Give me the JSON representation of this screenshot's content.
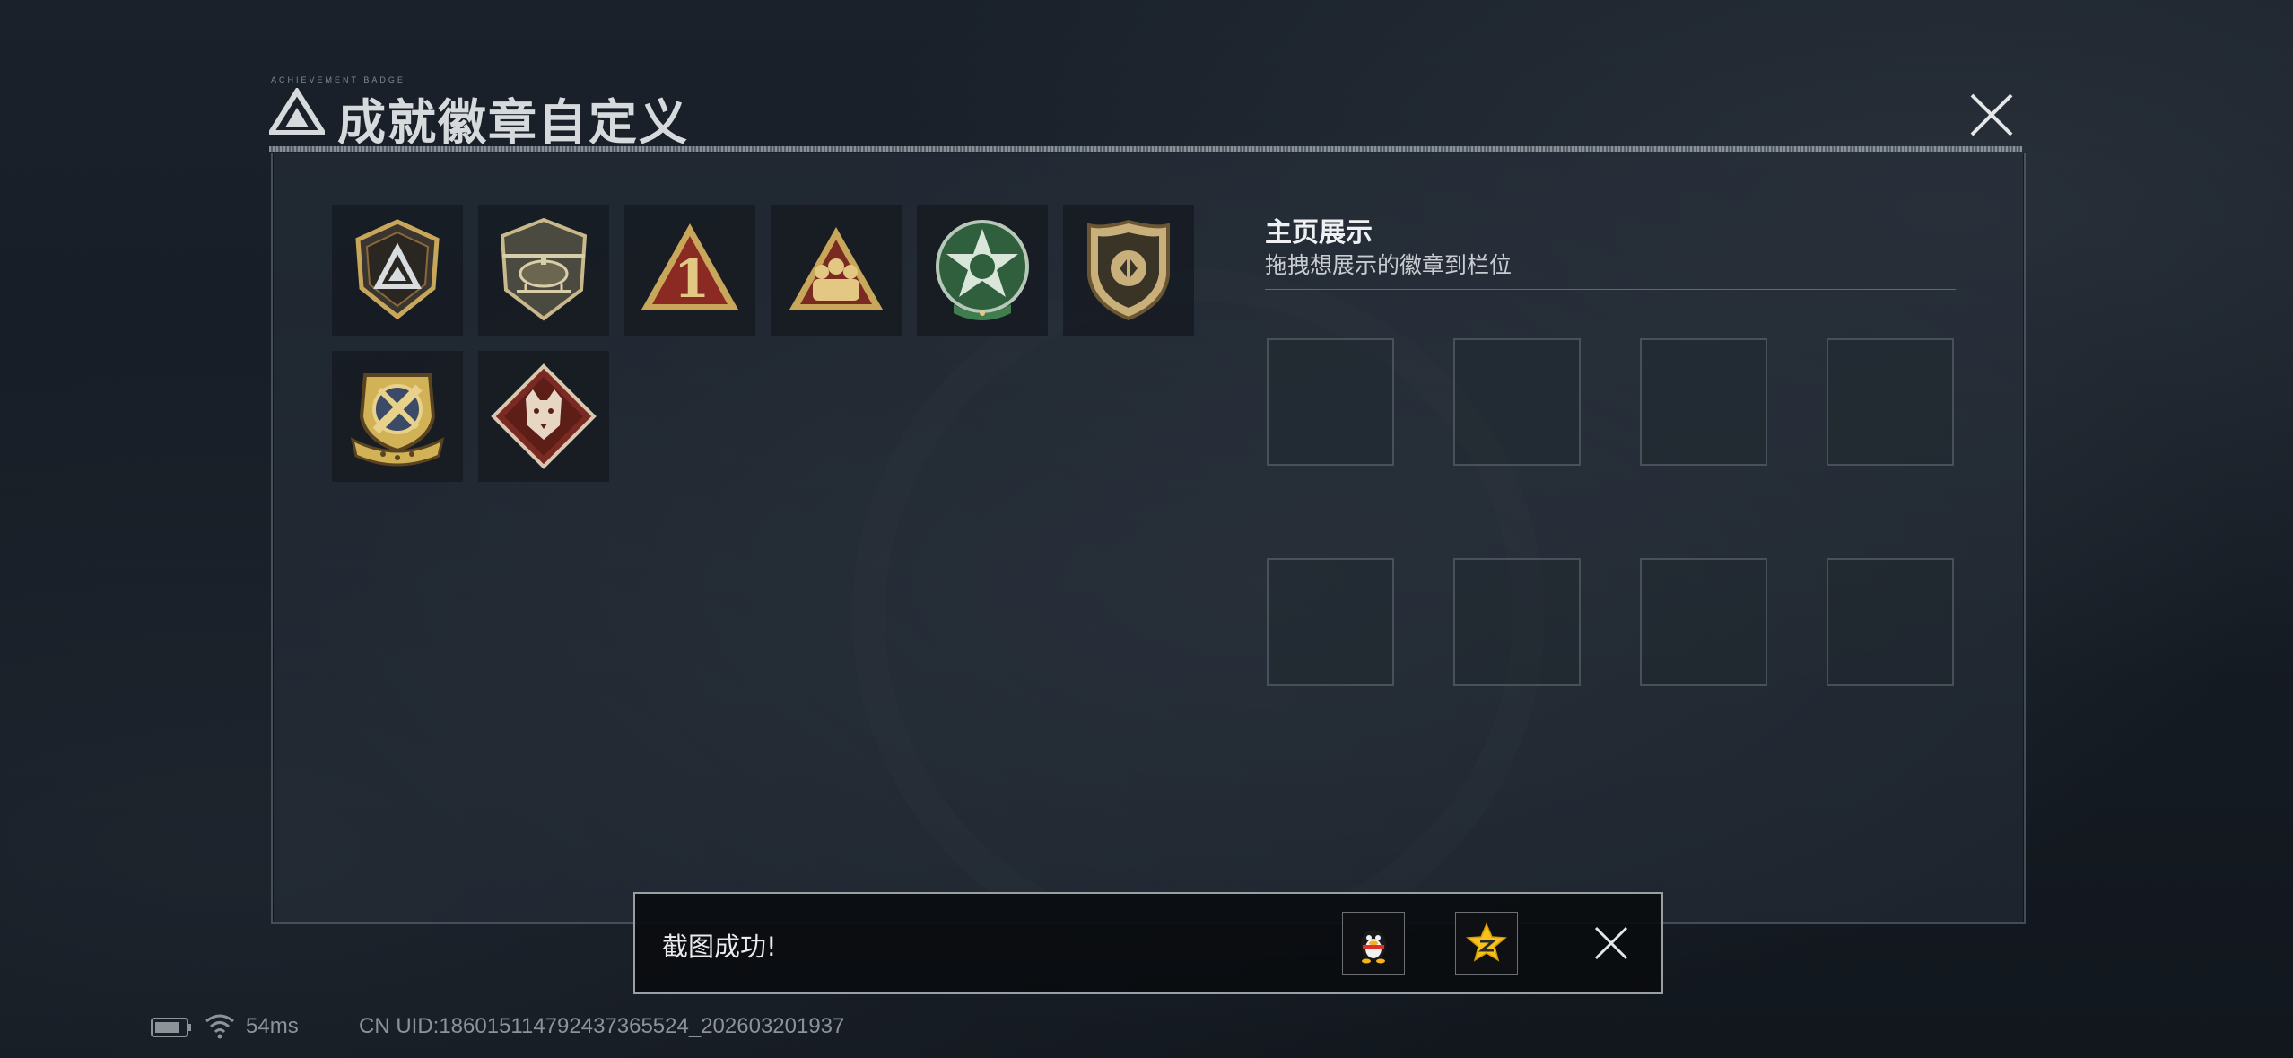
{
  "header": {
    "title": "成就徽章自定义",
    "tiny_text": "ACHIEVEMENT BADGE",
    "logo_icon": "triangle-logo-icon",
    "close_icon": "close-icon"
  },
  "badges": [
    {
      "name": "badge-triangle-shield",
      "icon": "triangle-shield-icon"
    },
    {
      "name": "badge-helicopter",
      "icon": "helicopter-icon"
    },
    {
      "name": "badge-number-one",
      "icon": "number-one-triangle-icon",
      "label": "1"
    },
    {
      "name": "badge-squad",
      "icon": "squad-triangle-icon"
    },
    {
      "name": "badge-green-star",
      "icon": "green-star-icon"
    },
    {
      "name": "badge-police-shield",
      "icon": "police-shield-icon"
    },
    {
      "name": "badge-wrench-gold",
      "icon": "gold-wrench-icon"
    },
    {
      "name": "badge-wolf-diamond",
      "icon": "wolf-diamond-icon"
    }
  ],
  "showcase": {
    "title": "主页展示",
    "subtitle": "拖拽想展示的徽章到栏位",
    "slots": 8
  },
  "toast": {
    "message": "截图成功!",
    "share_qq_icon": "qq-penguin-icon",
    "share_qzone_icon": "qzone-star-icon",
    "close_icon": "close-icon"
  },
  "status": {
    "battery_icon": "battery-icon",
    "wifi_icon": "wifi-icon",
    "ping": "54ms",
    "uid": "CN UID:18601511479243736552​4_202603201937"
  },
  "colors": {
    "gold": "#c9a75a",
    "bronze": "#8a6a3a",
    "red": "#8a2a22",
    "green": "#3f7d4e",
    "panel_border": "#8c96a0"
  }
}
